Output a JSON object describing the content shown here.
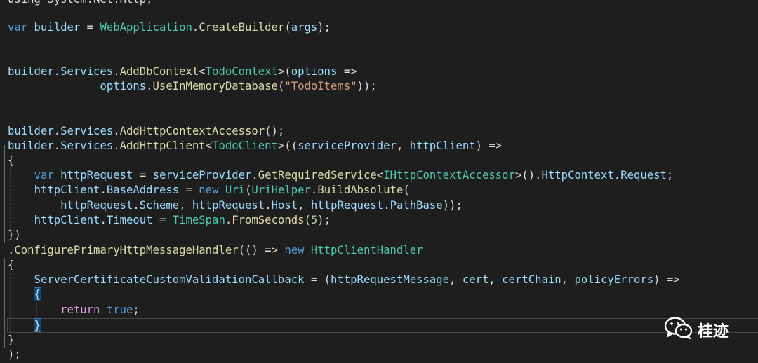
{
  "code": {
    "line0": [
      {
        "t": "using System.Net.Http;",
        "c": "pl"
      }
    ],
    "line1": [
      {
        "t": "var",
        "c": "kw"
      },
      {
        "t": " builder ",
        "c": "var"
      },
      {
        "t": "= ",
        "c": "pl"
      },
      {
        "t": "WebApplication",
        "c": "ty"
      },
      {
        "t": ".",
        "c": "pl"
      },
      {
        "t": "CreateBuilder",
        "c": "fn"
      },
      {
        "t": "(",
        "c": "pl"
      },
      {
        "t": "args",
        "c": "var"
      },
      {
        "t": ");",
        "c": "pl"
      }
    ],
    "line2": [
      {
        "t": "builder",
        "c": "var"
      },
      {
        "t": ".",
        "c": "pl"
      },
      {
        "t": "Services",
        "c": "var"
      },
      {
        "t": ".",
        "c": "pl"
      },
      {
        "t": "AddDbContext",
        "c": "fn"
      },
      {
        "t": "<",
        "c": "pl"
      },
      {
        "t": "TodoContext",
        "c": "ty"
      },
      {
        "t": ">(",
        "c": "pl"
      },
      {
        "t": "options",
        "c": "var"
      },
      {
        "t": " =>",
        "c": "pl"
      }
    ],
    "line3": [
      {
        "t": "              ",
        "c": "pl"
      },
      {
        "t": "options",
        "c": "var"
      },
      {
        "t": ".",
        "c": "pl"
      },
      {
        "t": "UseInMemoryDatabase",
        "c": "fn"
      },
      {
        "t": "(",
        "c": "pl"
      },
      {
        "t": "\"TodoItems\"",
        "c": "str"
      },
      {
        "t": "));",
        "c": "pl"
      }
    ],
    "line4": [
      {
        "t": "builder",
        "c": "var"
      },
      {
        "t": ".",
        "c": "pl"
      },
      {
        "t": "Services",
        "c": "var"
      },
      {
        "t": ".",
        "c": "pl"
      },
      {
        "t": "AddHttpContextAccessor",
        "c": "fn"
      },
      {
        "t": "();",
        "c": "pl"
      }
    ],
    "line5": [
      {
        "t": "builder",
        "c": "var"
      },
      {
        "t": ".",
        "c": "pl"
      },
      {
        "t": "Services",
        "c": "var"
      },
      {
        "t": ".",
        "c": "pl"
      },
      {
        "t": "AddHttpClient",
        "c": "fn"
      },
      {
        "t": "<",
        "c": "pl"
      },
      {
        "t": "TodoClient",
        "c": "ty"
      },
      {
        "t": ">((",
        "c": "pl"
      },
      {
        "t": "serviceProvider",
        "c": "var"
      },
      {
        "t": ", ",
        "c": "pl"
      },
      {
        "t": "httpClient",
        "c": "var"
      },
      {
        "t": ") =>",
        "c": "pl"
      }
    ],
    "line6": [
      {
        "t": "{",
        "c": "pl"
      }
    ],
    "line7": [
      {
        "t": "    ",
        "c": "pl"
      },
      {
        "t": "var",
        "c": "kw"
      },
      {
        "t": " httpRequest ",
        "c": "var"
      },
      {
        "t": "= ",
        "c": "pl"
      },
      {
        "t": "serviceProvider",
        "c": "var"
      },
      {
        "t": ".",
        "c": "pl"
      },
      {
        "t": "GetRequiredService",
        "c": "fn"
      },
      {
        "t": "<",
        "c": "pl"
      },
      {
        "t": "IHttpContextAccessor",
        "c": "ty"
      },
      {
        "t": ">().",
        "c": "pl"
      },
      {
        "t": "HttpContext",
        "c": "var"
      },
      {
        "t": ".",
        "c": "pl"
      },
      {
        "t": "Request",
        "c": "var"
      },
      {
        "t": ";",
        "c": "pl"
      }
    ],
    "line8": [
      {
        "t": "    ",
        "c": "pl"
      },
      {
        "t": "httpClient",
        "c": "var"
      },
      {
        "t": ".",
        "c": "pl"
      },
      {
        "t": "BaseAddress",
        "c": "var"
      },
      {
        "t": " = ",
        "c": "pl"
      },
      {
        "t": "new",
        "c": "kw"
      },
      {
        "t": " ",
        "c": "pl"
      },
      {
        "t": "Uri",
        "c": "ty"
      },
      {
        "t": "(",
        "c": "pl"
      },
      {
        "t": "UriHelper",
        "c": "ty"
      },
      {
        "t": ".",
        "c": "pl"
      },
      {
        "t": "BuildAbsolute",
        "c": "fn"
      },
      {
        "t": "(",
        "c": "pl"
      }
    ],
    "line9": [
      {
        "t": "        ",
        "c": "pl"
      },
      {
        "t": "httpRequest",
        "c": "var"
      },
      {
        "t": ".",
        "c": "pl"
      },
      {
        "t": "Scheme",
        "c": "var"
      },
      {
        "t": ", ",
        "c": "pl"
      },
      {
        "t": "httpRequest",
        "c": "var"
      },
      {
        "t": ".",
        "c": "pl"
      },
      {
        "t": "Host",
        "c": "var"
      },
      {
        "t": ", ",
        "c": "pl"
      },
      {
        "t": "httpRequest",
        "c": "var"
      },
      {
        "t": ".",
        "c": "pl"
      },
      {
        "t": "PathBase",
        "c": "var"
      },
      {
        "t": "));",
        "c": "pl"
      }
    ],
    "line10": [
      {
        "t": "    ",
        "c": "pl"
      },
      {
        "t": "httpClient",
        "c": "var"
      },
      {
        "t": ".",
        "c": "pl"
      },
      {
        "t": "Timeout",
        "c": "var"
      },
      {
        "t": " = ",
        "c": "pl"
      },
      {
        "t": "TimeSpan",
        "c": "ty"
      },
      {
        "t": ".",
        "c": "pl"
      },
      {
        "t": "FromSeconds",
        "c": "fn"
      },
      {
        "t": "(",
        "c": "pl"
      },
      {
        "t": "5",
        "c": "num"
      },
      {
        "t": ");",
        "c": "pl"
      }
    ],
    "line11": [
      {
        "t": "})",
        "c": "pl"
      }
    ],
    "line12": [
      {
        "t": ".",
        "c": "pl"
      },
      {
        "t": "ConfigurePrimaryHttpMessageHandler",
        "c": "fn"
      },
      {
        "t": "(() => ",
        "c": "pl"
      },
      {
        "t": "new",
        "c": "kw"
      },
      {
        "t": " ",
        "c": "pl"
      },
      {
        "t": "HttpClientHandler",
        "c": "ty"
      }
    ],
    "line13": [
      {
        "t": "{",
        "c": "pl"
      }
    ],
    "line14": [
      {
        "t": "    ",
        "c": "pl"
      },
      {
        "t": "ServerCertificateCustomValidationCallback",
        "c": "var"
      },
      {
        "t": " = (",
        "c": "pl"
      },
      {
        "t": "httpRequestMessage",
        "c": "var"
      },
      {
        "t": ", ",
        "c": "pl"
      },
      {
        "t": "cert",
        "c": "var"
      },
      {
        "t": ", ",
        "c": "pl"
      },
      {
        "t": "certChain",
        "c": "var"
      },
      {
        "t": ", ",
        "c": "pl"
      },
      {
        "t": "policyErrors",
        "c": "var"
      },
      {
        "t": ") =>",
        "c": "pl"
      }
    ],
    "line15": [
      {
        "t": "    ",
        "c": "pl"
      },
      {
        "t": "{",
        "c": "pl brace-hl"
      }
    ],
    "line16": [
      {
        "t": "        ",
        "c": "pl"
      },
      {
        "t": "return",
        "c": "ctl"
      },
      {
        "t": " ",
        "c": "pl"
      },
      {
        "t": "true",
        "c": "kw"
      },
      {
        "t": ";",
        "c": "pl"
      }
    ],
    "line17": [
      {
        "t": "    ",
        "c": "pl"
      },
      {
        "t": "}",
        "c": "pl brace-hl"
      }
    ],
    "line18": [
      {
        "t": "}",
        "c": "pl"
      }
    ],
    "line19": [
      {
        "t": ");",
        "c": "pl"
      }
    ]
  },
  "watermark": {
    "icon": "wechat-icon",
    "label": "桂迹"
  }
}
